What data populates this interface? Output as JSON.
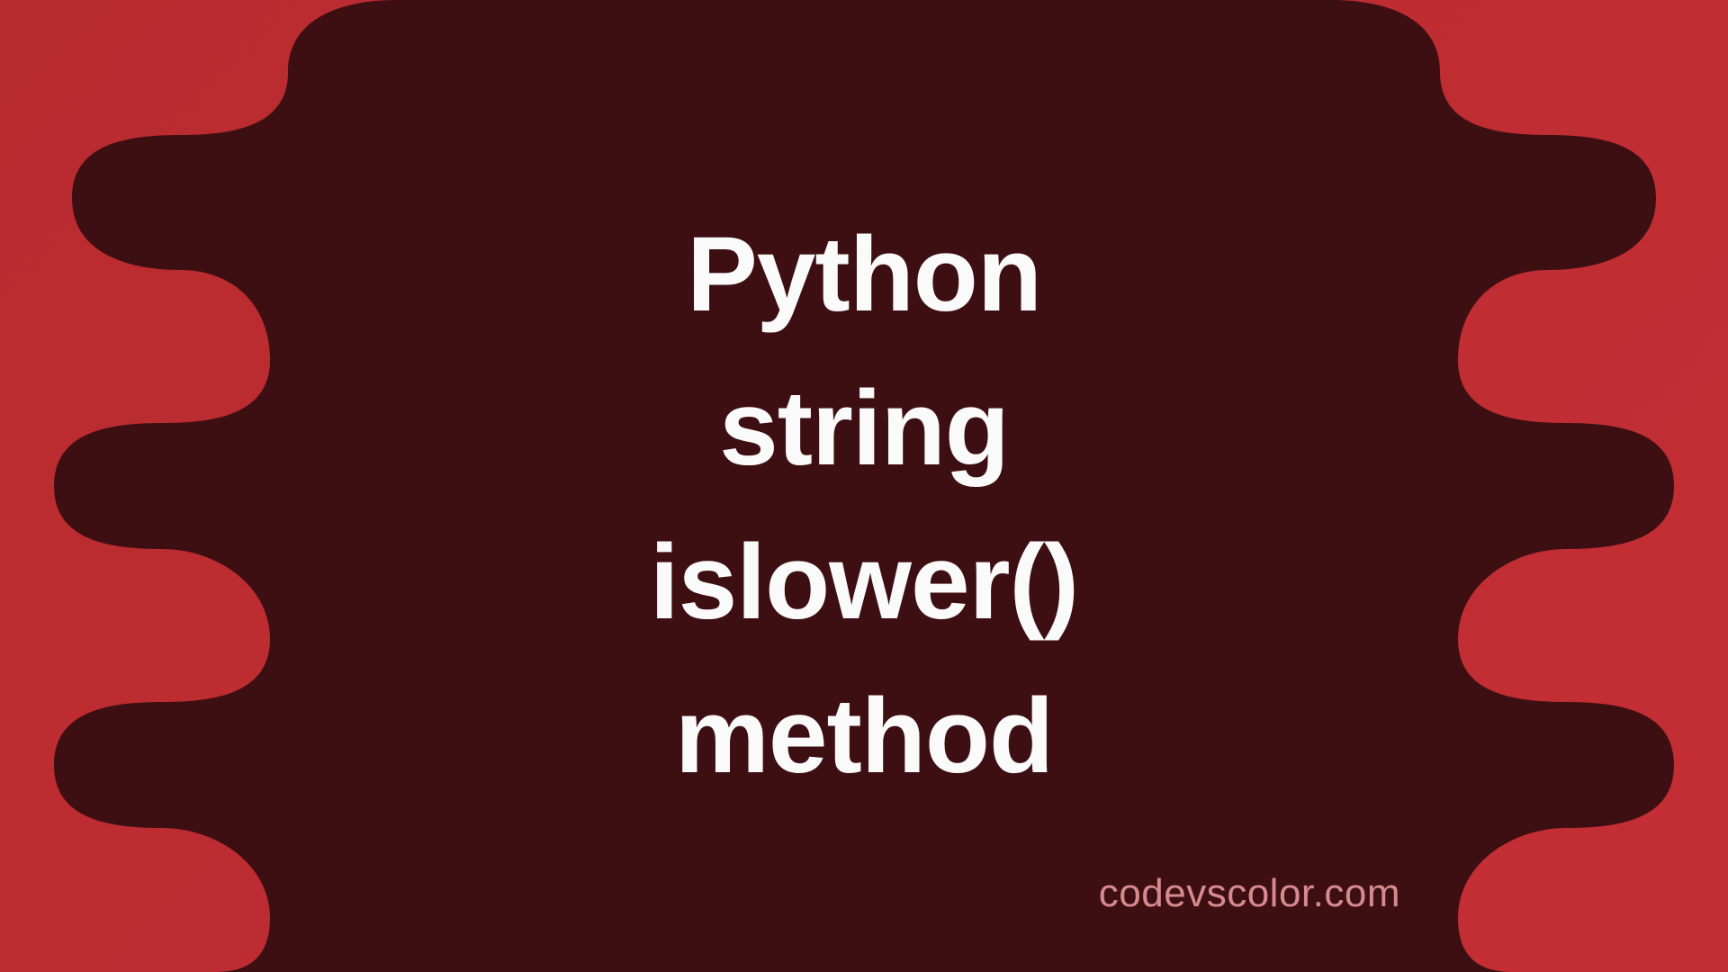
{
  "title": {
    "lines": [
      "Python",
      "string",
      "islower()",
      "method"
    ]
  },
  "watermark": "codevscolor.com",
  "colors": {
    "background_red": "#bd2e33",
    "dark_maroon": "#3e0f12",
    "text": "#fafafa",
    "watermark": "#d68a8e"
  }
}
